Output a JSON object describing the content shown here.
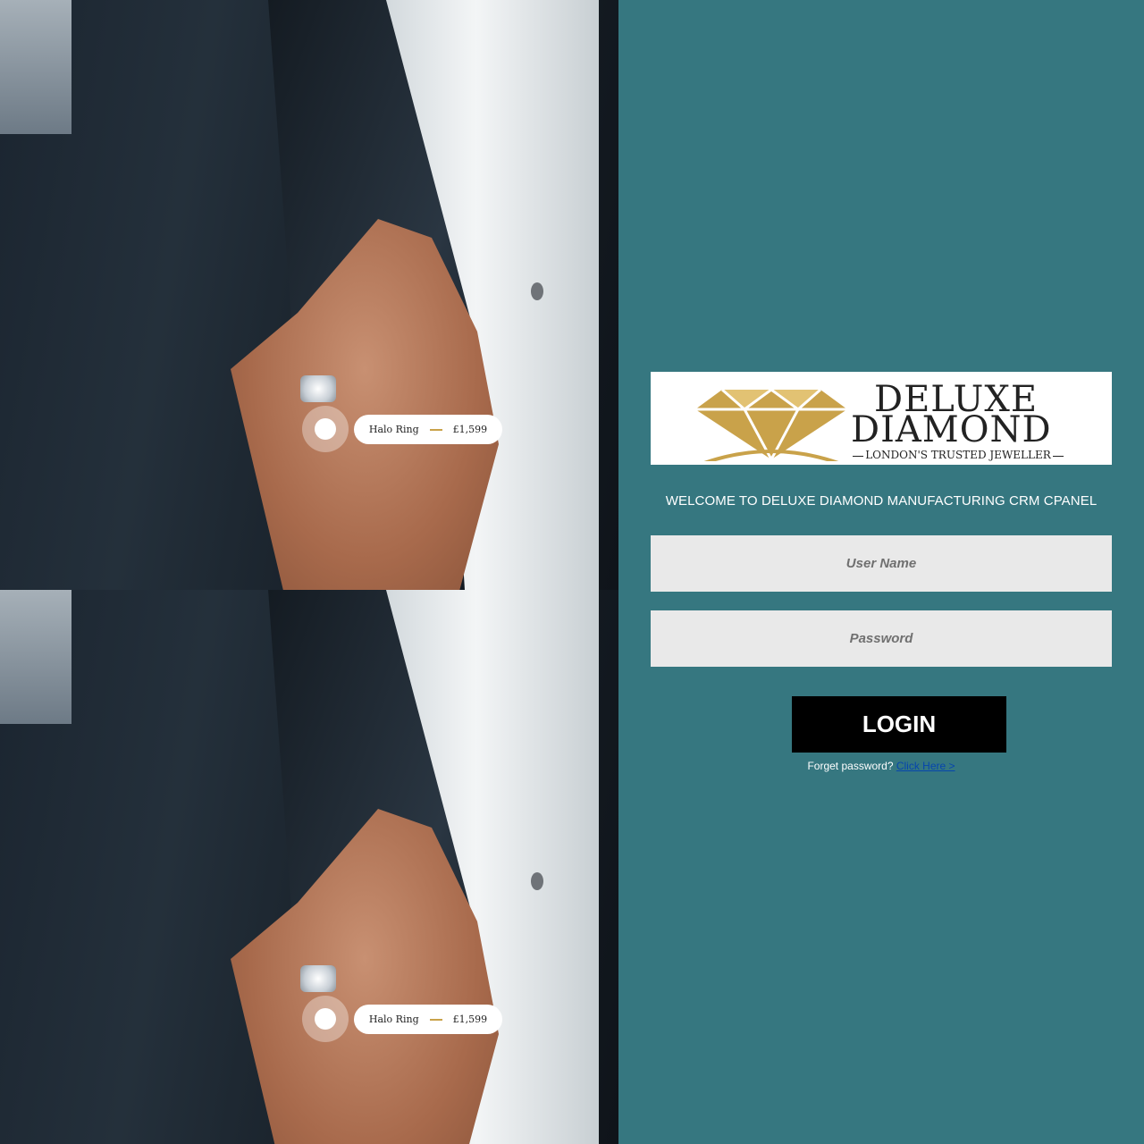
{
  "hero": {
    "panels": [
      {
        "product": "Halo Ring",
        "price": "£1,599"
      },
      {
        "product": "Halo Ring",
        "price": "£1,599"
      }
    ]
  },
  "logo": {
    "line1": "DELUXE",
    "line2": "DIAMOND",
    "tagline": "LONDON'S TRUSTED JEWELLER",
    "gold": "#C9A24A"
  },
  "login": {
    "welcome": "WELCOME TO DELUXE DIAMOND MANUFACTURING CRM CPANEL",
    "username_placeholder": "User Name",
    "password_placeholder": "Password",
    "button_label": "LOGIN",
    "forgot_text": "Forget password?",
    "forgot_link": "Click Here >"
  },
  "colors": {
    "panel_bg": "#367780",
    "field_bg": "#E9E9E9",
    "button_bg": "#000000"
  }
}
